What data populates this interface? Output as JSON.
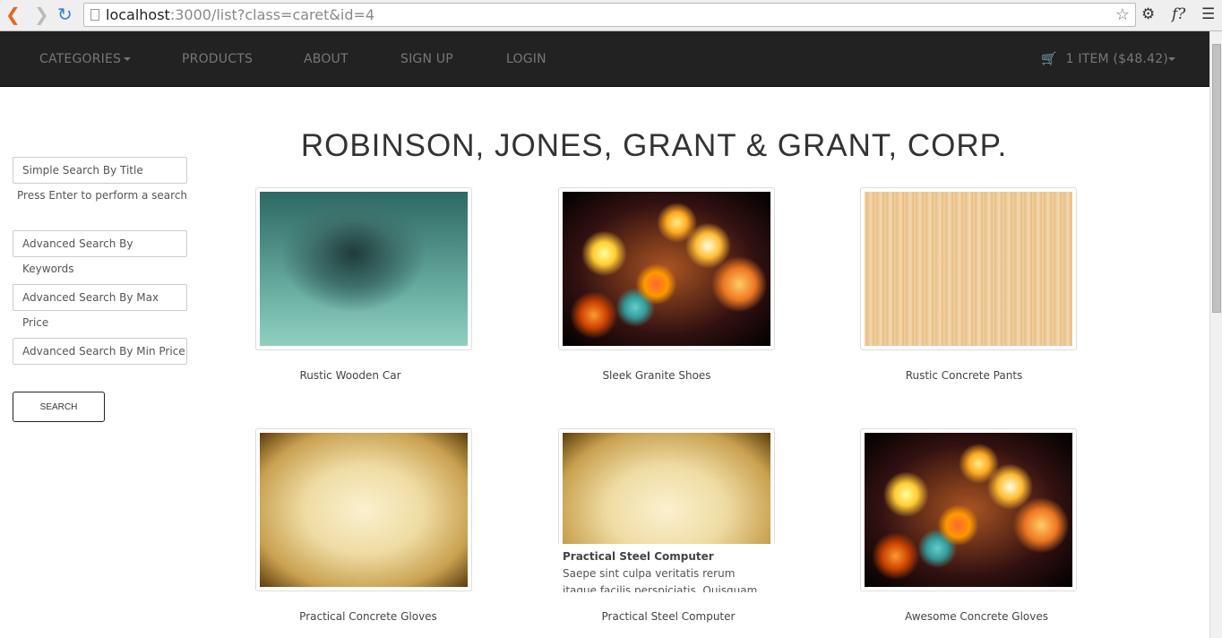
{
  "browser": {
    "url_host": "localhost",
    "url_rest": ":3000/list?class=caret&id=4"
  },
  "nav": {
    "items": [
      "CATEGORIES",
      "PRODUCTS",
      "ABOUT",
      "SIGN UP",
      "LOGIN"
    ],
    "cart": "1 ITEM ($48.42)"
  },
  "sidebar": {
    "simple_search": "Simple Search By Title",
    "hint": "Press Enter to perform a search",
    "keywords": "Advanced Search By Keywords",
    "max_price": "Advanced Search By Max Price",
    "min_price": "Advanced Search By Min Price",
    "search": "SEARCH"
  },
  "title": "ROBINSON, JONES, GRANT & GRANT, CORP.",
  "products": [
    {
      "name": "Rustic Wooden Car"
    },
    {
      "name": "Sleek Granite Shoes"
    },
    {
      "name": "Rustic Concrete Pants"
    },
    {
      "name": "Practical Concrete Gloves"
    },
    {
      "name": "Practical Steel Computer"
    },
    {
      "name": "Awesome Concrete Gloves"
    }
  ],
  "hover": {
    "title": "Practical Steel Computer",
    "text": "Saepe sint culpa veritatis rerum itaque facilis perspiciatis. Quisquam occaecati"
  }
}
